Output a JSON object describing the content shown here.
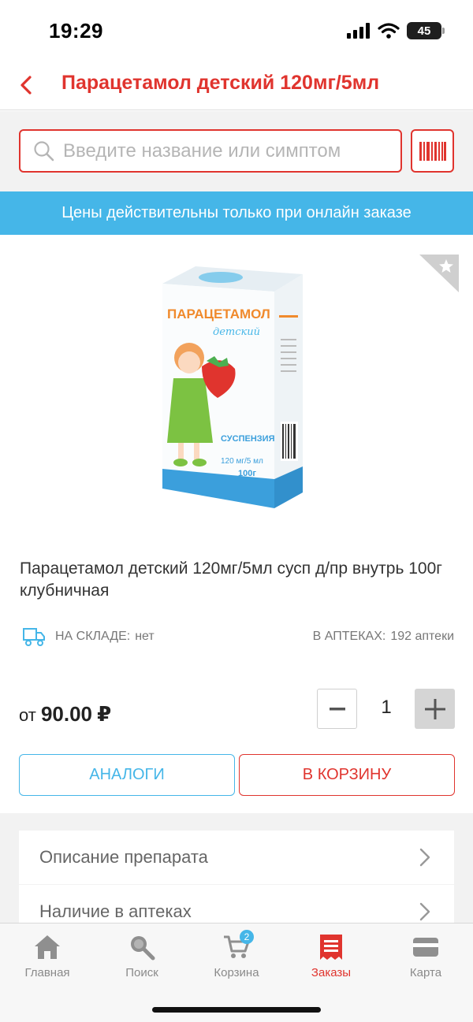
{
  "status_bar": {
    "time": "19:29",
    "battery": "45"
  },
  "header": {
    "title": "Парацетамол детский 120мг/5мл"
  },
  "search": {
    "placeholder": "Введите название или симптом"
  },
  "banner": {
    "text": "Цены действительны только при онлайн заказе"
  },
  "product": {
    "package_brand": "ПАРАЦЕТАМОЛ",
    "package_sub": "детский",
    "package_form": "СУСПЕНЗИЯ",
    "package_dose": "120 мг/5 мл",
    "package_weight": "100г",
    "name": "Парацетамол детский 120мг/5мл сусп д/пр внутрь 100г клубничная",
    "warehouse_label": "НА СКЛАДЕ:",
    "warehouse_value": "нет",
    "pharmacies_label": "В АПТЕКАХ:",
    "pharmacies_value": "192 аптеки",
    "price_prefix": "от",
    "price_value": "90.00",
    "currency": "₽",
    "quantity": "1"
  },
  "actions": {
    "analogs": "АНАЛОГИ",
    "add_to_cart": "В КОРЗИНУ"
  },
  "info_rows": [
    {
      "label": "Описание препарата"
    },
    {
      "label": "Наличие в аптеках"
    }
  ],
  "tabs": [
    {
      "label": "Главная",
      "icon": "home-icon"
    },
    {
      "label": "Поиск",
      "icon": "search-icon"
    },
    {
      "label": "Корзина",
      "icon": "cart-icon",
      "badge": "2"
    },
    {
      "label": "Заказы",
      "icon": "orders-icon",
      "active": true
    },
    {
      "label": "Карта",
      "icon": "card-icon"
    }
  ],
  "colors": {
    "accent_red": "#e0342e",
    "accent_blue": "#45b6e8",
    "background_gray": "#f2f2f2"
  }
}
